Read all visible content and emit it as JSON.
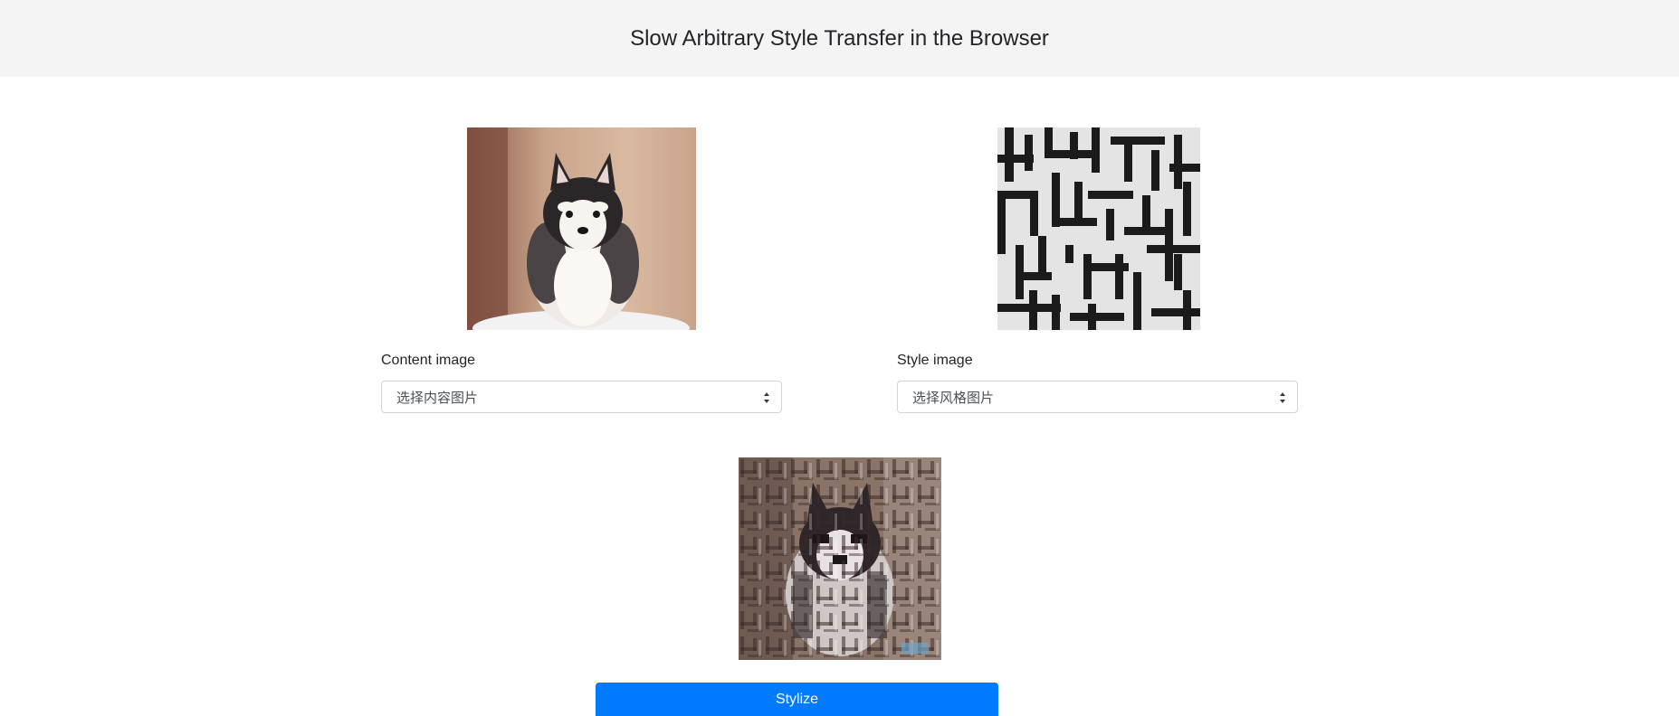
{
  "header": {
    "title": "Slow Arbitrary Style Transfer in the Browser"
  },
  "content": {
    "label": "Content image",
    "select_value": "选择内容图片",
    "image_icon": "husky-puppy-image"
  },
  "style": {
    "label": "Style image",
    "select_value": "选择风格图片",
    "image_icon": "maze-pattern-image"
  },
  "result": {
    "image_icon": "stylized-result-image"
  },
  "actions": {
    "stylize_label": "Stylize"
  },
  "colors": {
    "accent": "#007bff",
    "header_bg": "#f4f4f4"
  }
}
